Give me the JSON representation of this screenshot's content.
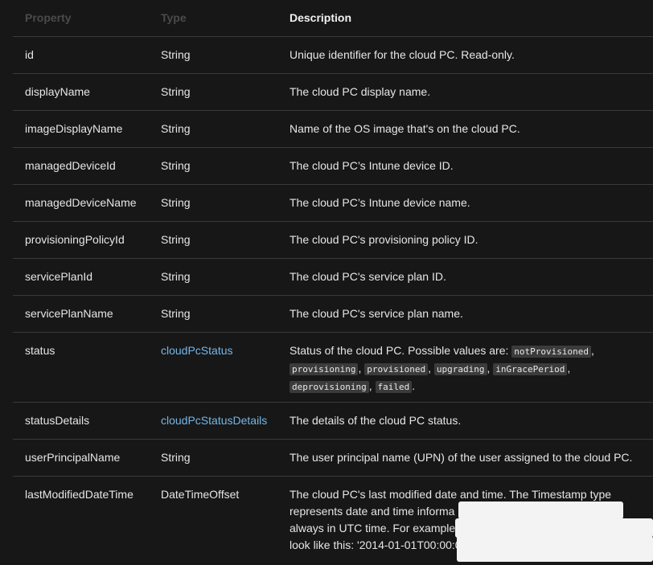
{
  "header": {
    "property": "Property",
    "type": "Type",
    "description": "Description"
  },
  "rows": [
    {
      "name": "id",
      "type": "String",
      "description": "Unique identifier for the cloud PC. Read-only."
    },
    {
      "name": "displayName",
      "type": "String",
      "description": "The cloud PC display name."
    },
    {
      "name": "imageDisplayName",
      "type": "String",
      "description": "Name of the OS image that's on the cloud PC."
    },
    {
      "name": "managedDeviceId",
      "type": "String",
      "description": "The cloud PC’s Intune device ID."
    },
    {
      "name": "managedDeviceName",
      "type": "String",
      "description": "The cloud PC’s Intune device name."
    },
    {
      "name": "provisioningPolicyId",
      "type": "String",
      "description": "The cloud PC's provisioning policy ID."
    },
    {
      "name": "servicePlanId",
      "type": "String",
      "description": "The cloud PC's service plan ID."
    },
    {
      "name": "servicePlanName",
      "type": "String",
      "description": "The cloud PC's service plan name."
    }
  ],
  "status_row": {
    "name": "status",
    "type": "cloudPcStatus",
    "description": "Status of the cloud PC. Possible values are:",
    "values": [
      "notProvisioned",
      "provisioning",
      "provisioned",
      "upgrading",
      "inGracePeriod",
      "deprovisioning",
      "failed"
    ]
  },
  "details_row": {
    "name": "statusDetails",
    "type": "cloudPcStatusDetails",
    "description": "The details of the cloud PC status."
  },
  "upn_row": {
    "name": "userPrincipalName",
    "type": "String",
    "description": "The user principal name (UPN) of the user assigned to the cloud PC."
  },
  "last_row": {
    "name": "lastModifiedDateTime",
    "type": "DateTimeOffset",
    "line1": "The cloud PC's last modified date and time. The Timestamp type",
    "line2": "represents date and time informa",
    "line3": "always in UTC time. For example,",
    "line4": "look like this: '2014-01-01T00:00:0"
  },
  "colors": {
    "background": "#171717",
    "divider": "#3a3a3a",
    "link": "#75b6e7",
    "code_bg": "#3b3b3b"
  }
}
